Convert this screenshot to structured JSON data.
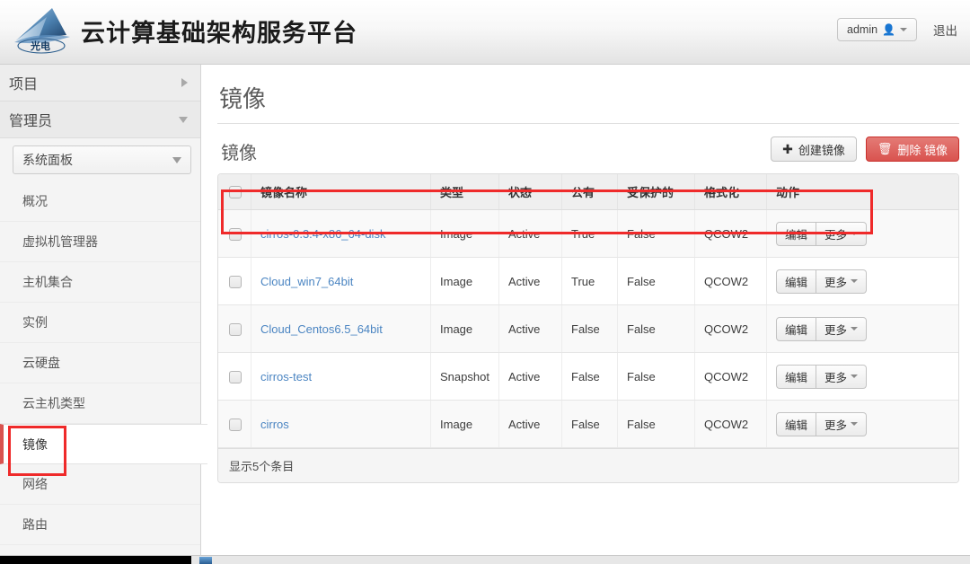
{
  "header": {
    "brand_title": "云计算基础架构服务平台",
    "logo_icon": "mountain-logo-icon",
    "logo_text": "光电",
    "user_button_label": "admin",
    "user_icon": "person-icon",
    "caret_icon": "chevron-down-icon",
    "logout_label": "退出"
  },
  "sidebar": {
    "groups": [
      {
        "label": "项目",
        "icon": "chevron-right-icon"
      },
      {
        "label": "管理员",
        "icon": "chevron-down-icon"
      }
    ],
    "panel_select": {
      "value": "系统面板",
      "icon": "chevron-down-icon"
    },
    "items": [
      {
        "label": "概况"
      },
      {
        "label": "虚拟机管理器"
      },
      {
        "label": "主机集合"
      },
      {
        "label": "实例"
      },
      {
        "label": "云硬盘"
      },
      {
        "label": "云主机类型"
      },
      {
        "label": "镜像"
      },
      {
        "label": "网络"
      },
      {
        "label": "路由"
      }
    ],
    "active_index": 6
  },
  "main": {
    "page_title": "镜像",
    "panel_title": "镜像",
    "buttons": {
      "create": {
        "label": "创建镜像",
        "icon": "plus-icon"
      },
      "delete": {
        "label": "删除 镜像",
        "icon": "trash-icon"
      }
    },
    "table": {
      "columns": [
        "镜像名称",
        "类型",
        "状态",
        "公有",
        "受保护的",
        "格式化",
        "动作"
      ],
      "select_all_icon": "checkbox-icon",
      "rows": [
        {
          "name": "cirros-0.3.4-x86_64-disk",
          "type": "Image",
          "status": "Active",
          "public": "True",
          "protected": "False",
          "format": "QCOW2"
        },
        {
          "name": "Cloud_win7_64bit",
          "type": "Image",
          "status": "Active",
          "public": "True",
          "protected": "False",
          "format": "QCOW2"
        },
        {
          "name": "Cloud_Centos6.5_64bit",
          "type": "Image",
          "status": "Active",
          "public": "False",
          "protected": "False",
          "format": "QCOW2"
        },
        {
          "name": "cirros-test",
          "type": "Snapshot",
          "status": "Active",
          "public": "False",
          "protected": "False",
          "format": "QCOW2"
        },
        {
          "name": "cirros",
          "type": "Image",
          "status": "Active",
          "public": "False",
          "protected": "False",
          "format": "QCOW2"
        }
      ],
      "row_actions": {
        "edit_label": "编辑",
        "more_label": "更多",
        "more_icon": "chevron-down-icon"
      },
      "footer_text": "显示5个条目"
    }
  },
  "annotations": {
    "highlight_color": "#ef2a2a",
    "boxes": [
      "first-image-row",
      "sidebar-item-images"
    ]
  }
}
